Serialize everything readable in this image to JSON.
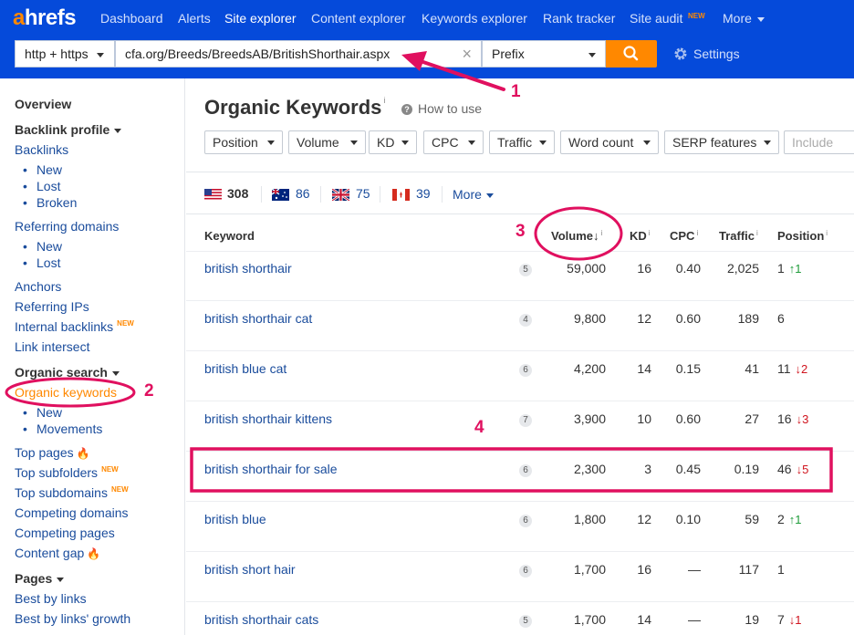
{
  "logo": {
    "brand": "ahrefs",
    "first": "a",
    "rest": "hrefs"
  },
  "nav": {
    "items": [
      "Dashboard",
      "Alerts",
      "Site explorer",
      "Content explorer",
      "Keywords explorer",
      "Rank tracker",
      "Site audit",
      "More"
    ],
    "site_audit_badge": "NEW",
    "active": "Site explorer"
  },
  "search": {
    "protocol": "http + https",
    "target": "cfa.org/Breeds/BreedsAB/BritishShorthair.aspx",
    "clear": "×",
    "mode": "Prefix",
    "settings_label": "Settings"
  },
  "sidebar": {
    "overview": "Overview",
    "backlink_profile": "Backlink profile",
    "backlinks": "Backlinks",
    "backlinks_sub": [
      "New",
      "Lost",
      "Broken"
    ],
    "referring_domains": "Referring domains",
    "referring_domains_sub": [
      "New",
      "Lost"
    ],
    "anchors": "Anchors",
    "referring_ips": "Referring IPs",
    "internal_backlinks": "Internal backlinks",
    "internal_backlinks_badge": "NEW",
    "link_intersect": "Link intersect",
    "organic_search": "Organic search",
    "organic_keywords": "Organic keywords",
    "organic_keywords_sub": [
      "New",
      "Movements"
    ],
    "top_pages": "Top pages",
    "top_subfolders": "Top subfolders",
    "top_subfolders_badge": "NEW",
    "top_subdomains": "Top subdomains",
    "top_subdomains_badge": "NEW",
    "competing_domains": "Competing domains",
    "competing_pages": "Competing pages",
    "content_gap": "Content gap",
    "pages": "Pages",
    "best_by_links": "Best by links",
    "best_by_links_growth": "Best by links' growth"
  },
  "main": {
    "title": "Organic Keywords",
    "title_info": "i",
    "how_to_use": "How to use",
    "filters": [
      "Position",
      "Volume",
      "KD",
      "CPC",
      "Traffic",
      "Word count",
      "SERP features"
    ],
    "include_placeholder": "Include",
    "countries": [
      {
        "code": "US",
        "count": "308"
      },
      {
        "code": "AU",
        "count": "86"
      },
      {
        "code": "GB",
        "count": "75"
      },
      {
        "code": "CA",
        "count": "39"
      }
    ],
    "more_countries": "More"
  },
  "table": {
    "headers": {
      "keyword": "Keyword",
      "volume": "Volume",
      "kd": "KD",
      "cpc": "CPC",
      "traffic": "Traffic",
      "position": "Position"
    },
    "sort_arrow": "↓",
    "rows": [
      {
        "keyword": "british shorthair",
        "serp": "5",
        "volume": "59,000",
        "kd": "16",
        "cpc": "0.40",
        "traffic": "2,025",
        "position": "1",
        "change": "1",
        "dir": "up"
      },
      {
        "keyword": "british shorthair cat",
        "serp": "4",
        "volume": "9,800",
        "kd": "12",
        "cpc": "0.60",
        "traffic": "189",
        "position": "6",
        "change": "",
        "dir": ""
      },
      {
        "keyword": "british blue cat",
        "serp": "6",
        "volume": "4,200",
        "kd": "14",
        "cpc": "0.15",
        "traffic": "41",
        "position": "11",
        "change": "2",
        "dir": "down"
      },
      {
        "keyword": "british shorthair kittens",
        "serp": "7",
        "volume": "3,900",
        "kd": "10",
        "cpc": "0.60",
        "traffic": "27",
        "position": "16",
        "change": "3",
        "dir": "down"
      },
      {
        "keyword": "british shorthair for sale",
        "serp": "6",
        "volume": "2,300",
        "kd": "3",
        "cpc": "0.45",
        "traffic": "0.19",
        "position": "46",
        "change": "5",
        "dir": "down"
      },
      {
        "keyword": "british blue",
        "serp": "6",
        "volume": "1,800",
        "kd": "12",
        "cpc": "0.10",
        "traffic": "59",
        "position": "2",
        "change": "1",
        "dir": "up"
      },
      {
        "keyword": "british short hair",
        "serp": "6",
        "volume": "1,700",
        "kd": "16",
        "cpc": "—",
        "traffic": "117",
        "position": "1",
        "change": "",
        "dir": ""
      },
      {
        "keyword": "british shorthair cats",
        "serp": "5",
        "volume": "1,700",
        "kd": "14",
        "cpc": "—",
        "traffic": "19",
        "position": "7",
        "change": "1",
        "dir": "down"
      }
    ]
  },
  "annotations": {
    "numbers": [
      "1",
      "2",
      "3",
      "4"
    ],
    "color": "#e0105f"
  },
  "colors": {
    "nav_bg": "#054ada",
    "accent": "#ff8800",
    "link": "#1a4c9c",
    "up": "#1f9c3a",
    "down": "#d0141e"
  }
}
